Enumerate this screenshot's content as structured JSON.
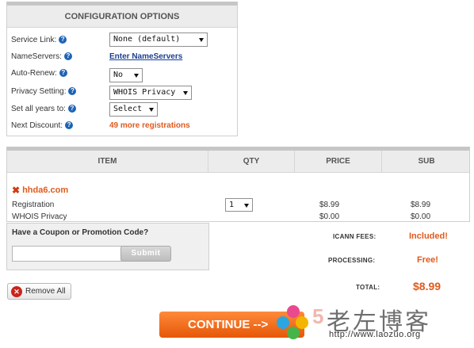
{
  "config": {
    "title": "CONFIGURATION OPTIONS",
    "rows": [
      {
        "label": "Service Link:",
        "value": "None (default)"
      },
      {
        "label": "NameServers:",
        "value": "Enter NameServers"
      },
      {
        "label": "Auto-Renew:",
        "value": "No"
      },
      {
        "label": "Privacy Setting:",
        "value": "WHOIS Privacy"
      },
      {
        "label": "Set all years to:",
        "value": "Select"
      },
      {
        "label": "Next Discount:",
        "value": "49 more registrations"
      }
    ],
    "help_glyph": "?"
  },
  "cart": {
    "headers": {
      "item": "ITEM",
      "qty": "QTY",
      "price": "PRICE",
      "sub": "SUB"
    },
    "domain": "hhda6.com",
    "remove_glyph": "✖",
    "lines": [
      {
        "item": "Registration",
        "qty": "1",
        "price": "$8.99",
        "sub": "$8.99"
      },
      {
        "item": "WHOIS Privacy",
        "qty": "",
        "price": "$0.00",
        "sub": "$0.00"
      }
    ]
  },
  "coupon": {
    "title": "Have a Coupon or Promotion Code?",
    "input_value": "",
    "submit_label": "Submit"
  },
  "totals": {
    "icann_label": "ICANN FEES:",
    "icann_value": "Included!",
    "processing_label": "PROCESSING:",
    "processing_value": "Free!",
    "total_label": "TOTAL:",
    "total_value": "$8.99"
  },
  "actions": {
    "remove_all_label": "Remove All",
    "remove_glyph": "✕",
    "continue_label": "CONTINUE -->"
  },
  "watermark": {
    "number": "5",
    "chinese": "老左博客",
    "url": "http://www.laozuo.org"
  },
  "colors": {
    "accent_orange": "#e05a1e",
    "link_blue": "#1a3f92",
    "help_blue": "#1f63b4",
    "continue_orange": "#e55708"
  }
}
